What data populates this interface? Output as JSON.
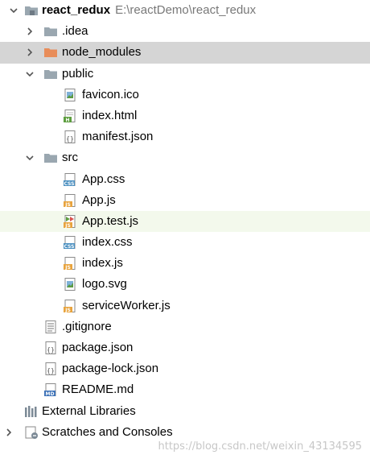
{
  "project": {
    "name": "react_redux",
    "path": "E:\\reactDemo\\react_redux"
  },
  "folders": {
    "idea": ".idea",
    "node_modules": "node_modules",
    "public": "public",
    "src": "src"
  },
  "public_files": [
    "favicon.ico",
    "index.html",
    "manifest.json"
  ],
  "src_files": [
    "App.css",
    "App.js",
    "App.test.js",
    "index.css",
    "index.js",
    "logo.svg",
    "serviceWorker.js"
  ],
  "root_files": [
    ".gitignore",
    "package.json",
    "package-lock.json",
    "README.md"
  ],
  "bottom": {
    "external_libraries": "External Libraries",
    "scratches": "Scratches and Consoles"
  },
  "watermark": "https://blog.csdn.net/weixin_43134595",
  "icon_text": {
    "css": "CSS",
    "js": "JS",
    "html": "H",
    "md": "MD",
    "json": "{}"
  },
  "colors": {
    "selected_row": "#d5d5d5",
    "highlight_row": "#f3f9ec",
    "folder": "#9aa7b0",
    "excluded_folder": "#e88d5a",
    "js_badge": "#e8a33d",
    "css_badge": "#4a8fc0",
    "html_badge": "#5d9e3f",
    "md_badge": "#3e73b8"
  }
}
